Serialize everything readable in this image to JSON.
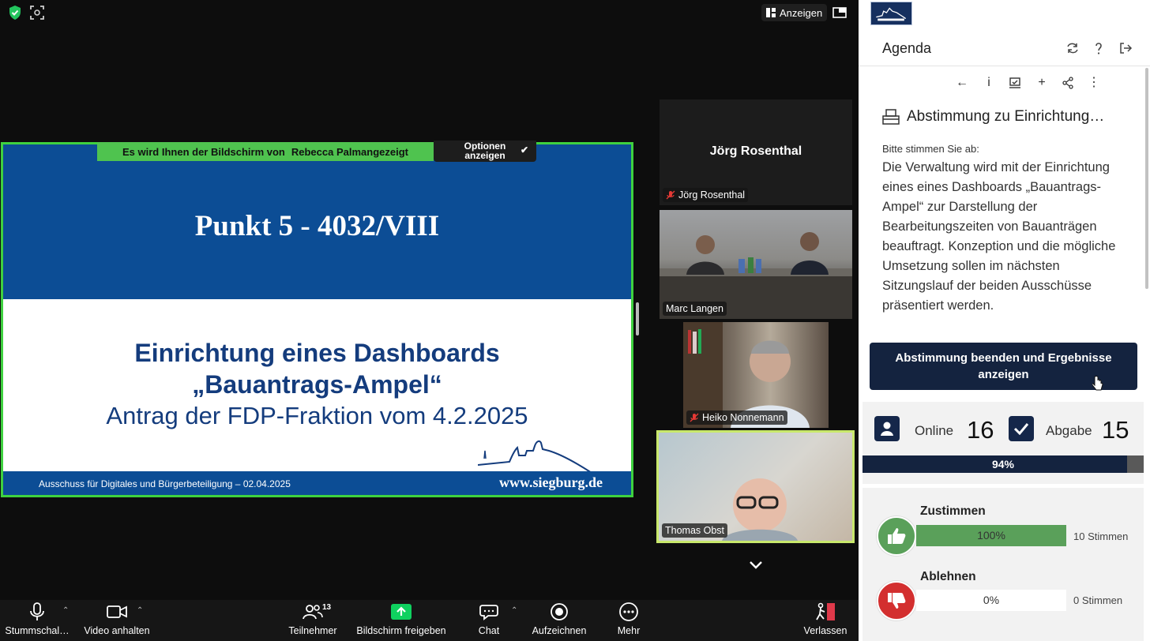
{
  "zoom": {
    "view_label": "Anzeigen",
    "share_banner": {
      "prefix": "Es wird Ihnen der Bildschirm von",
      "presenter": "Rebecca Palmangezeigt"
    },
    "options_button": "Optionen anzeigen",
    "slide": {
      "title": "Punkt 5 - 4032/VIII",
      "heading_line1": "Einrichtung eines Dashboards",
      "heading_line2": "„Bauantrags-Ampel“",
      "subheading": "Antrag der FDP-Fraktion vom 4.2.2025",
      "footer_left": "Ausschuss für Digitales und Bürgerbeteiligung – 02.04.2025",
      "footer_right": "www.siegburg.de",
      "colors": {
        "blue": "#0c4d95",
        "text": "#143c7d"
      }
    },
    "participants": [
      {
        "name": "Jörg Rosenthal",
        "muted": true,
        "video": false
      },
      {
        "name": "Marc Langen",
        "muted": false,
        "video": true
      },
      {
        "name": "Heiko Nonnemann",
        "muted": true,
        "video": true
      },
      {
        "name": "Thomas Obst",
        "muted": false,
        "video": true,
        "speaking": true
      }
    ],
    "toolbar": {
      "mute": "Stummschal…",
      "video": "Video anhalten",
      "participants": "Teilnehmer",
      "participants_count": "13",
      "share": "Bildschirm freigeben",
      "chat": "Chat",
      "record": "Aufzeichnen",
      "more": "Mehr",
      "leave": "Verlassen"
    }
  },
  "panel": {
    "title": "Agenda",
    "vote": {
      "title": "Abstimmung zu Einrichtung…",
      "prompt": "Bitte stimmen Sie ab:",
      "text": "Die Verwaltung wird mit der Einrichtung eines eines Dashboards „Bauantrags-Ampel“ zur Darstellung der Bearbeitungszeiten von Bauanträgen beauftragt. Konzeption und die mögliche Umsetzung sollen im nächsten Sitzungslauf der beiden Ausschüsse präsentiert werden.",
      "end_button": "Abstimmung beenden und Ergebnisse anzeigen"
    },
    "stats": {
      "online_label": "Online",
      "online_value": "16",
      "submitted_label": "Abgabe",
      "submitted_value": "15",
      "progress_label": "94%",
      "progress_fraction": 0.94
    },
    "options": [
      {
        "name": "Zustimmen",
        "percent_label": "100%",
        "fraction": 1.0,
        "votes": "10 Stimmen",
        "color": "#5aa05a",
        "icon": "thumbs-up-icon"
      },
      {
        "name": "Ablehnen",
        "percent_label": "0%",
        "fraction": 0.0,
        "votes": "0 Stimmen",
        "color": "#d32f2f",
        "icon": "thumbs-down-icon"
      }
    ]
  }
}
